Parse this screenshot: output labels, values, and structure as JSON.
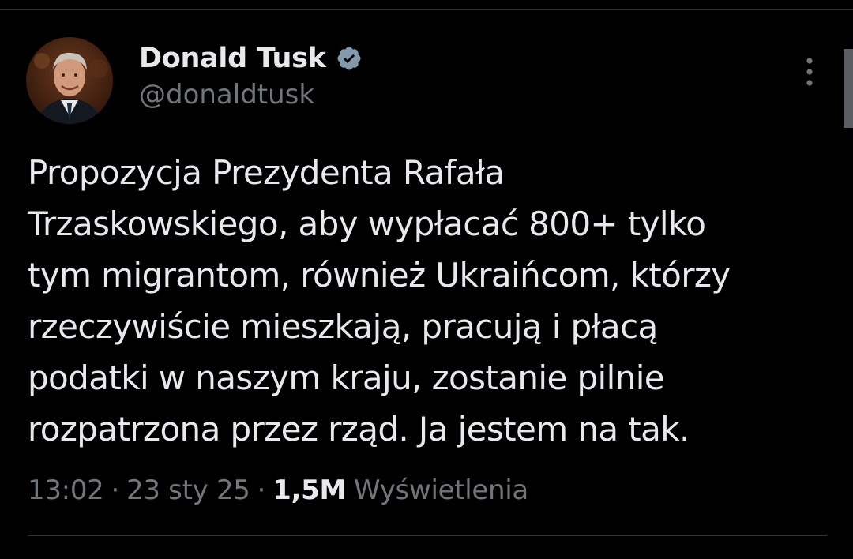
{
  "author": {
    "display_name": "Donald Tusk",
    "handle": "@donaldtusk",
    "verified": true,
    "verified_color": "#1d9bf0"
  },
  "tweet": {
    "lines": [
      "Propozycja Prezydenta Rafała",
      "Trzaskowskiego, aby wypłacać 800+ tylko",
      "tym migrantom, również Ukraińcom, którzy",
      "rzeczywiście mieszkają, pracują i płacą",
      "podatki w naszym kraju, zostanie pilnie",
      "rozpatrzona przez rząd. Ja jestem na tak."
    ]
  },
  "meta": {
    "time": "13:02",
    "separator": "·",
    "date": "23 sty 25",
    "views_count": "1,5M",
    "views_label": "Wyświetlenia"
  },
  "icons": {
    "more": "more-vertical-icon",
    "verified": "verified-badge-icon"
  },
  "colors": {
    "background": "#000000",
    "primary_text": "#e7e9ea",
    "secondary_text": "#71767b",
    "divider": "#2f3336"
  }
}
